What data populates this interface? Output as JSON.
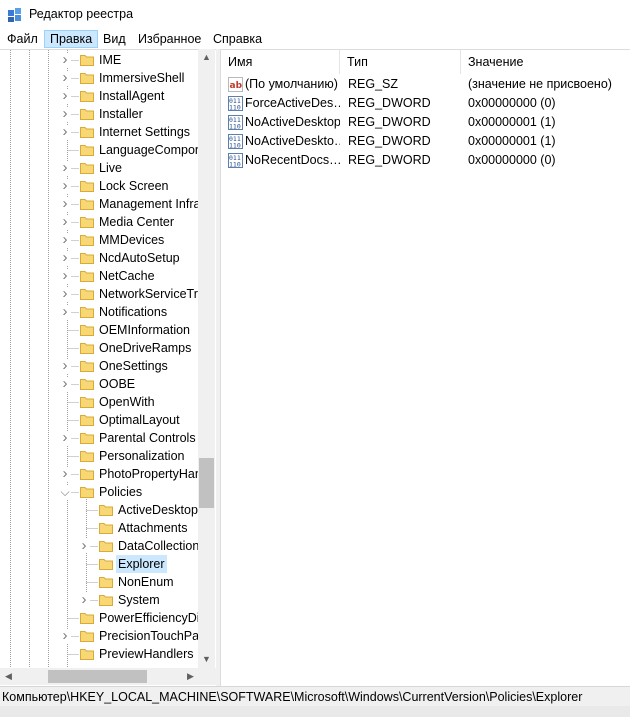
{
  "window": {
    "title": "Редактор реестра"
  },
  "menu": [
    {
      "label": "Файл",
      "active": false
    },
    {
      "label": "Правка",
      "active": true
    },
    {
      "label": "Вид",
      "active": false
    },
    {
      "label": "Избранное",
      "active": false
    },
    {
      "label": "Справка",
      "active": false
    }
  ],
  "tree": [
    {
      "label": "IME",
      "level": 1,
      "expander": "collapsed"
    },
    {
      "label": "ImmersiveShell",
      "level": 1,
      "expander": "collapsed"
    },
    {
      "label": "InstallAgent",
      "level": 1,
      "expander": "collapsed"
    },
    {
      "label": "Installer",
      "level": 1,
      "expander": "collapsed"
    },
    {
      "label": "Internet Settings",
      "level": 1,
      "expander": "collapsed"
    },
    {
      "label": "LanguageCompon",
      "level": 1,
      "expander": "none"
    },
    {
      "label": "Live",
      "level": 1,
      "expander": "collapsed"
    },
    {
      "label": "Lock Screen",
      "level": 1,
      "expander": "collapsed"
    },
    {
      "label": "Management Infra",
      "level": 1,
      "expander": "collapsed"
    },
    {
      "label": "Media Center",
      "level": 1,
      "expander": "collapsed"
    },
    {
      "label": "MMDevices",
      "level": 1,
      "expander": "collapsed"
    },
    {
      "label": "NcdAutoSetup",
      "level": 1,
      "expander": "collapsed"
    },
    {
      "label": "NetCache",
      "level": 1,
      "expander": "collapsed"
    },
    {
      "label": "NetworkServiceTrig",
      "level": 1,
      "expander": "collapsed"
    },
    {
      "label": "Notifications",
      "level": 1,
      "expander": "collapsed"
    },
    {
      "label": "OEMInformation",
      "level": 1,
      "expander": "none"
    },
    {
      "label": "OneDriveRamps",
      "level": 1,
      "expander": "none"
    },
    {
      "label": "OneSettings",
      "level": 1,
      "expander": "collapsed"
    },
    {
      "label": "OOBE",
      "level": 1,
      "expander": "collapsed"
    },
    {
      "label": "OpenWith",
      "level": 1,
      "expander": "none"
    },
    {
      "label": "OptimalLayout",
      "level": 1,
      "expander": "none"
    },
    {
      "label": "Parental Controls",
      "level": 1,
      "expander": "collapsed"
    },
    {
      "label": "Personalization",
      "level": 1,
      "expander": "none"
    },
    {
      "label": "PhotoPropertyHan",
      "level": 1,
      "expander": "collapsed"
    },
    {
      "label": "Policies",
      "level": 1,
      "expander": "expanded"
    },
    {
      "label": "ActiveDesktop",
      "level": 2,
      "expander": "none"
    },
    {
      "label": "Attachments",
      "level": 2,
      "expander": "none"
    },
    {
      "label": "DataCollection",
      "level": 2,
      "expander": "collapsed"
    },
    {
      "label": "Explorer",
      "level": 2,
      "expander": "none",
      "selected": true
    },
    {
      "label": "NonEnum",
      "level": 2,
      "expander": "none"
    },
    {
      "label": "System",
      "level": 2,
      "expander": "collapsed"
    },
    {
      "label": "PowerEfficiencyDia",
      "level": 1,
      "expander": "none"
    },
    {
      "label": "PrecisionTouchPac",
      "level": 1,
      "expander": "collapsed"
    },
    {
      "label": "PreviewHandlers",
      "level": 1,
      "expander": "none"
    }
  ],
  "list": {
    "columns": {
      "name": "Имя",
      "type": "Тип",
      "value": "Значение"
    },
    "rows": [
      {
        "name": "(По умолчанию)",
        "type": "REG_SZ",
        "value": "(значение не присвоено)",
        "icon": "string-value-icon"
      },
      {
        "name": "ForceActiveDes…",
        "type": "REG_DWORD",
        "value": "0x00000000 (0)",
        "icon": "dword-value-icon"
      },
      {
        "name": "NoActiveDesktop",
        "type": "REG_DWORD",
        "value": "0x00000001 (1)",
        "icon": "dword-value-icon"
      },
      {
        "name": "NoActiveDeskto…",
        "type": "REG_DWORD",
        "value": "0x00000001 (1)",
        "icon": "dword-value-icon"
      },
      {
        "name": "NoRecentDocs…",
        "type": "REG_DWORD",
        "value": "0x00000000 (0)",
        "icon": "dword-value-icon"
      }
    ]
  },
  "status": {
    "path": "Компьютер\\HKEY_LOCAL_MACHINE\\SOFTWARE\\Microsoft\\Windows\\CurrentVersion\\Policies\\Explorer"
  },
  "colors": {
    "selection": "#cce8ff",
    "folder": "#f8d775",
    "folder_edge": "#d9a93a",
    "chrome": "#f0f0f0"
  }
}
